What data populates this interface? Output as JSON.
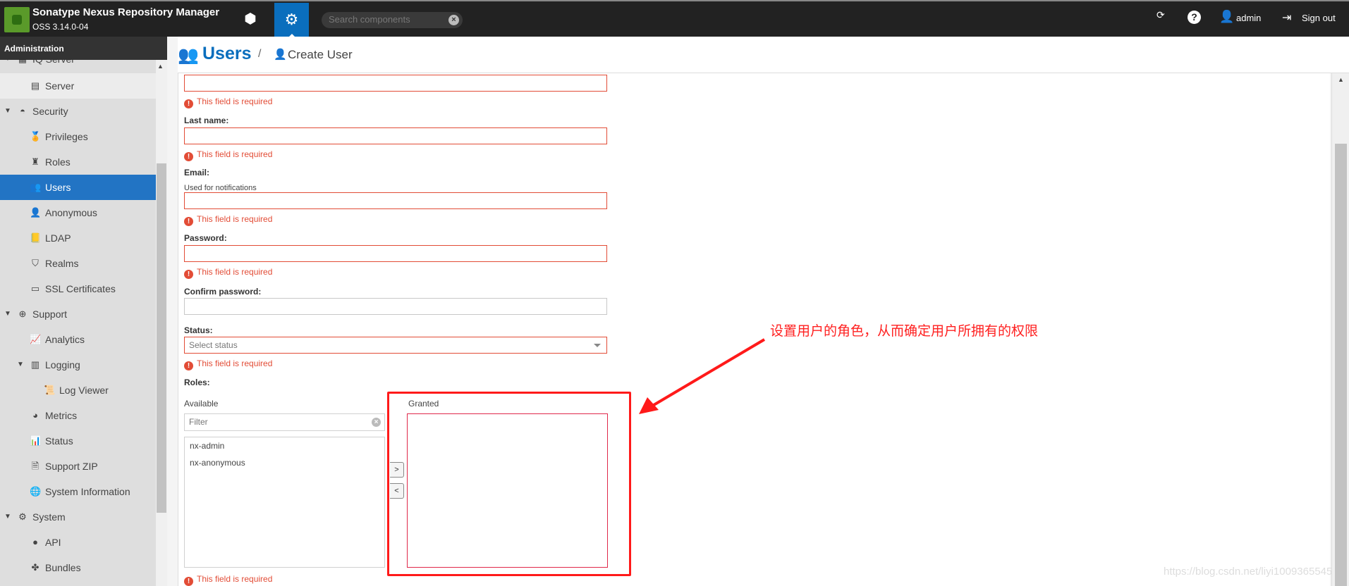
{
  "header": {
    "title": "Sonatype Nexus Repository Manager",
    "version": "OSS 3.14.0-04",
    "search_placeholder": "Search components",
    "user": "admin",
    "signout": "Sign out"
  },
  "sidebar": {
    "heading": "Administration",
    "items": [
      {
        "label": "IQ Server",
        "icon": "iq-server-icon",
        "indent": 0,
        "twisty": true
      },
      {
        "label": "Server",
        "icon": "server-icon",
        "indent": 1
      },
      {
        "label": "Security",
        "icon": "security-icon",
        "indent": 0,
        "twisty": true
      },
      {
        "label": "Privileges",
        "icon": "medal-icon",
        "indent": 1
      },
      {
        "label": "Roles",
        "icon": "role-icon",
        "indent": 1
      },
      {
        "label": "Users",
        "icon": "users-icon",
        "indent": 1,
        "selected": true
      },
      {
        "label": "Anonymous",
        "icon": "anonymous-icon",
        "indent": 1
      },
      {
        "label": "LDAP",
        "icon": "address-book-icon",
        "indent": 1
      },
      {
        "label": "Realms",
        "icon": "shield-icon",
        "indent": 1
      },
      {
        "label": "SSL Certificates",
        "icon": "certificate-icon",
        "indent": 1
      },
      {
        "label": "Support",
        "icon": "lifebuoy-icon",
        "indent": 0,
        "twisty": true
      },
      {
        "label": "Analytics",
        "icon": "analytics-icon",
        "indent": 1
      },
      {
        "label": "Logging",
        "icon": "book-icon",
        "indent": 1,
        "twisty": true
      },
      {
        "label": "Log Viewer",
        "icon": "scroll-icon",
        "indent": 2
      },
      {
        "label": "Metrics",
        "icon": "pie-chart-icon",
        "indent": 1
      },
      {
        "label": "Status",
        "icon": "status-icon",
        "indent": 1
      },
      {
        "label": "Support ZIP",
        "icon": "zip-icon",
        "indent": 1
      },
      {
        "label": "System Information",
        "icon": "globe-icon",
        "indent": 1
      },
      {
        "label": "System",
        "icon": "gear-icon",
        "indent": 0,
        "twisty": true
      },
      {
        "label": "API",
        "icon": "api-icon",
        "indent": 1
      },
      {
        "label": "Bundles",
        "icon": "puzzle-icon",
        "indent": 1
      }
    ]
  },
  "breadcrumb": {
    "title": "Users",
    "sep": "/",
    "sub": "Create User"
  },
  "form": {
    "required": "This field is required",
    "last_name": "Last name:",
    "email": "Email:",
    "email_help": "Used for notifications",
    "password": "Password:",
    "confirm": "Confirm password:",
    "status": "Status:",
    "status_placeholder": "Select status",
    "roles": "Roles:",
    "available": "Available",
    "granted": "Granted",
    "filter_placeholder": "Filter",
    "available_roles": [
      "nx-admin",
      "nx-anonymous"
    ],
    "add": ">",
    "remove": "<"
  },
  "annotation": {
    "text": "设置用户的角色，从而确定用户所拥有的权限",
    "color": "#ff1a1a"
  },
  "watermark": "https://blog.csdn.net/liyi1009365545",
  "colors": {
    "accent": "#0a6ebd",
    "error": "#e24c36",
    "selected": "#2274c4"
  }
}
